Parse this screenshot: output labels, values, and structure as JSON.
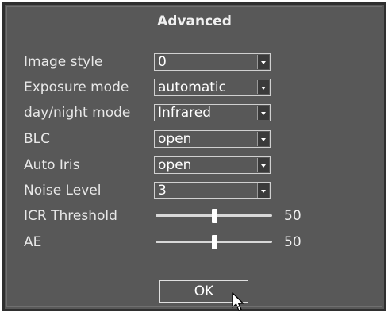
{
  "dialog": {
    "title": "Advanced"
  },
  "fields": {
    "image_style": {
      "label": "Image style",
      "value": "0"
    },
    "exposure_mode": {
      "label": "Exposure mode",
      "value": "automatic"
    },
    "day_night_mode": {
      "label": "day/night mode",
      "value": "Infrared"
    },
    "blc": {
      "label": "BLC",
      "value": "open"
    },
    "auto_iris": {
      "label": "Auto Iris",
      "value": "open"
    },
    "noise_level": {
      "label": "Noise Level",
      "value": "3"
    }
  },
  "sliders": {
    "icr_threshold": {
      "label": "ICR Threshold",
      "value": "50",
      "fraction": 0.5
    },
    "ae": {
      "label": "AE",
      "value": "50",
      "fraction": 0.5
    }
  },
  "buttons": {
    "ok": "OK"
  },
  "icons": {
    "dropdown": "chevron-down-icon",
    "cursor": "mouse-pointer-icon"
  }
}
